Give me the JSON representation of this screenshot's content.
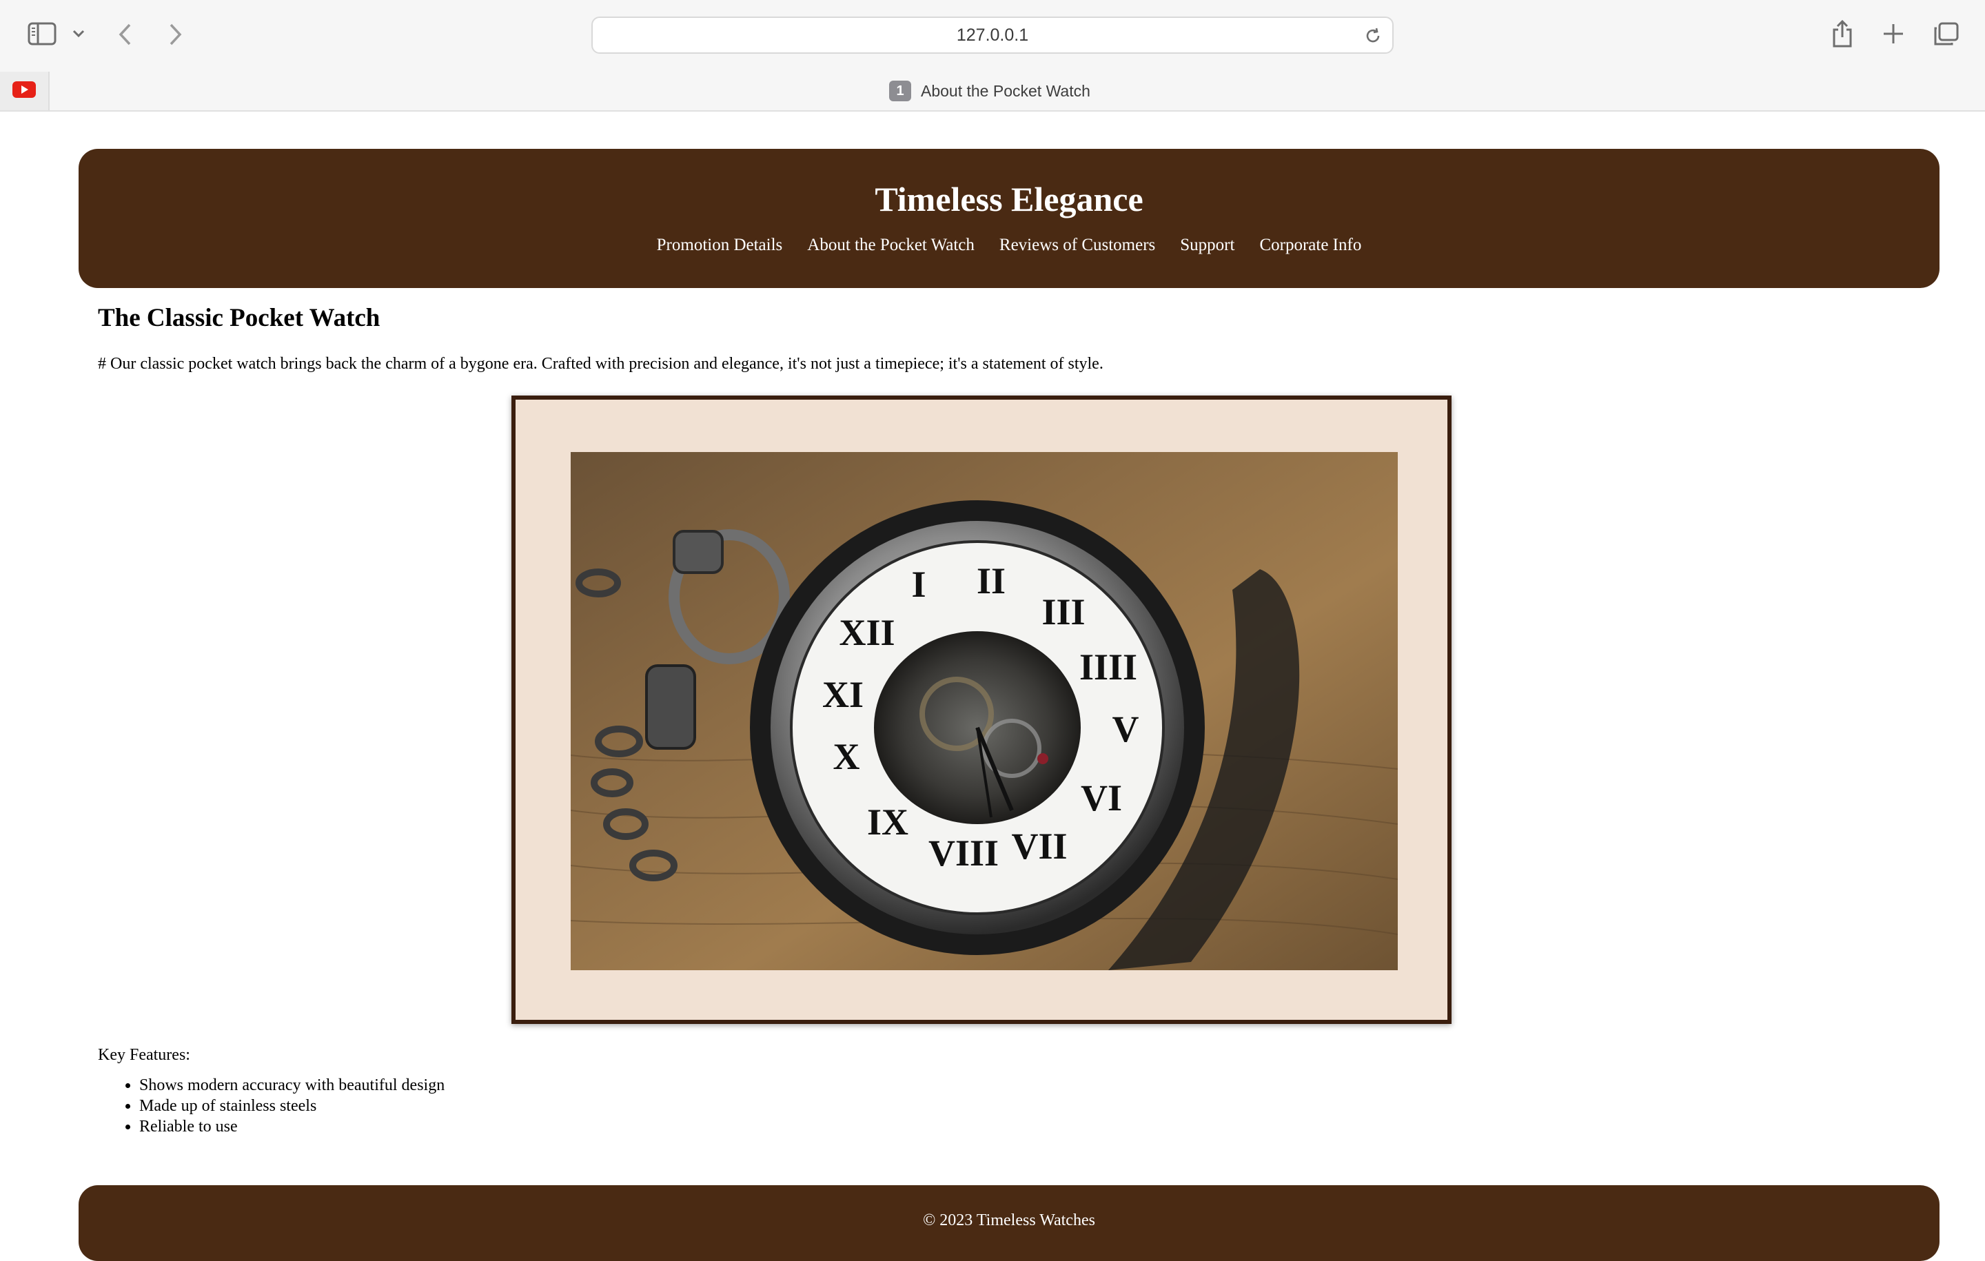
{
  "browser": {
    "url": "127.0.0.1",
    "tab_count": "1",
    "tab_title": "About the Pocket Watch",
    "icons": [
      "sidebar-icon",
      "chevron-down-icon",
      "back-icon",
      "forward-icon",
      "reload-icon",
      "share-icon",
      "new-tab-icon",
      "tab-overview-icon",
      "youtube-icon"
    ]
  },
  "header": {
    "title": "Timeless Elegance",
    "nav": [
      "Promotion Details",
      "About the Pocket Watch",
      "Reviews of Customers",
      "Support",
      "Corporate Info"
    ]
  },
  "main": {
    "heading": "The Classic Pocket Watch",
    "intro": "# Our classic pocket watch brings back the charm of a bygone era. Crafted with precision and elegance, it's not just a timepiece; it's a statement of style.",
    "image_alt": "Pocket watch photo",
    "features_label": "Key Features:",
    "features": [
      "Shows modern accuracy with beautiful design",
      "Made up of stainless steels",
      "Reliable to use"
    ]
  },
  "footer": {
    "text": "© 2023 Timeless Watches"
  },
  "colors": {
    "brand_brown": "#4a2a13",
    "frame_bg": "#f1e1d3",
    "frame_border": "#3a1e0e"
  }
}
